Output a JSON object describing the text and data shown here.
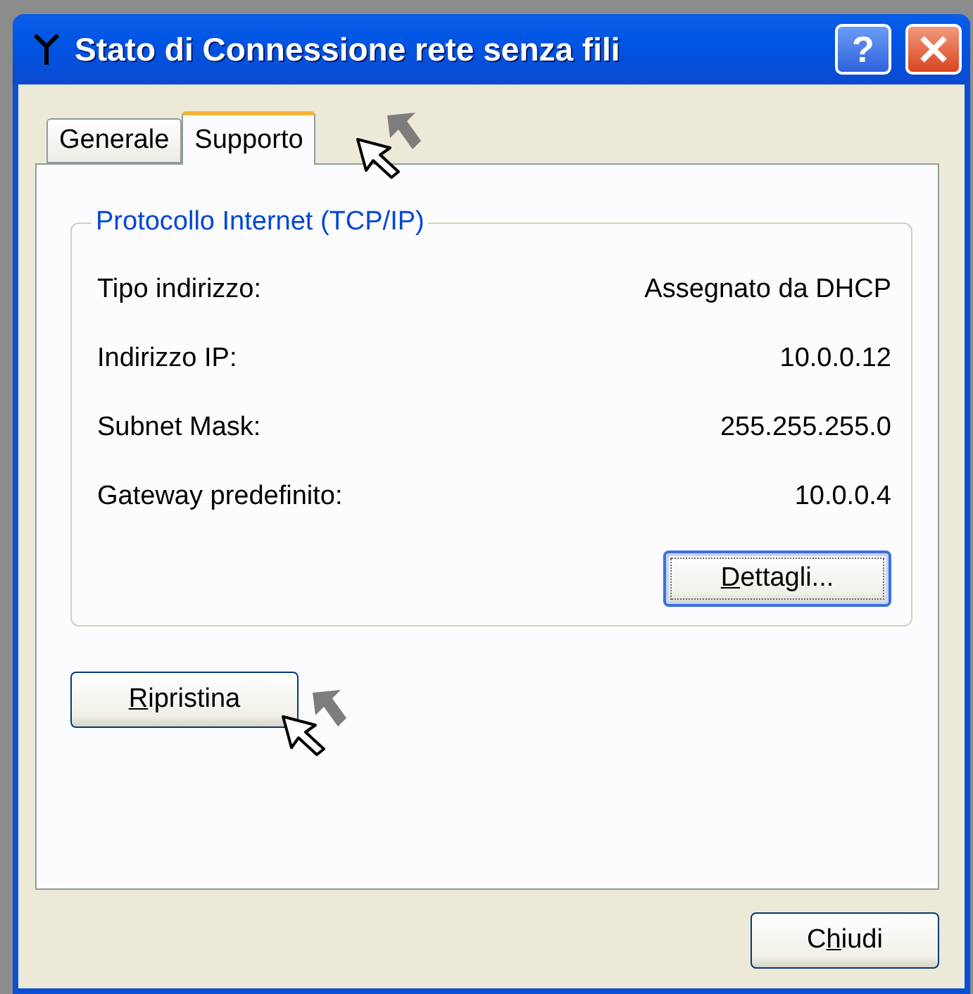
{
  "window": {
    "title": "Stato di Connessione rete senza fili",
    "buttons": [
      "?"
    ]
  },
  "tabs": [
    {
      "label": "Generale",
      "selected": false
    },
    {
      "label": "Supporto",
      "selected": true
    }
  ],
  "group": {
    "title": "Protocollo Internet (TCP/IP)",
    "rows": [
      {
        "label": "Tipo indirizzo:",
        "value": "Assegnato da DHCP"
      },
      {
        "label": "Indirizzo IP:",
        "value": "10.0.0.12"
      },
      {
        "label": "Subnet Mask:",
        "value": "255.255.255.0"
      },
      {
        "label": "Gateway predefinito:",
        "value": "10.0.0.4"
      }
    ],
    "button": {
      "key": "D",
      "after": "ettagli...",
      "focused": true
    }
  },
  "repair_button": {
    "key": "R",
    "after": "ipristina",
    "focused": false
  },
  "close_button": {
    "before": "C",
    "key": "h",
    "after": "iudi",
    "focused": false
  }
}
